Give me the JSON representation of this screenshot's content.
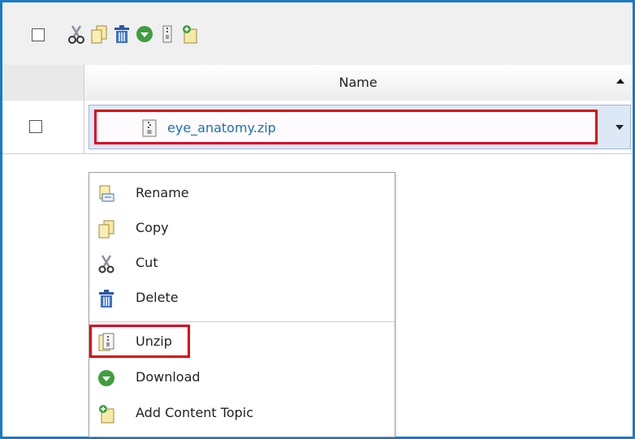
{
  "toolbar": {
    "icons": [
      "select-all-checkbox",
      "cut-icon",
      "copy-icon",
      "delete-icon",
      "download-icon",
      "zip-icon",
      "add-content-topic-icon"
    ]
  },
  "table": {
    "name_header": "Name",
    "rows": [
      {
        "file_name": "eye_anatomy.zip"
      }
    ]
  },
  "context_menu": {
    "items": [
      {
        "label": "Rename"
      },
      {
        "label": "Copy"
      },
      {
        "label": "Cut"
      },
      {
        "label": "Delete"
      },
      {
        "label": "Unzip"
      },
      {
        "label": "Download"
      },
      {
        "label": "Add Content Topic"
      }
    ]
  },
  "colors": {
    "frame_border": "#1a7ac4",
    "highlight": "#e0001b",
    "link": "#1f6fb8"
  }
}
